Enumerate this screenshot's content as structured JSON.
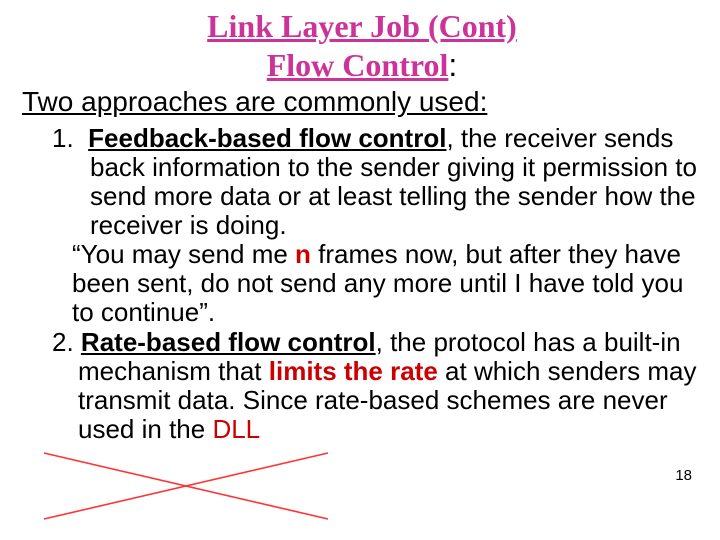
{
  "title": "Link Layer Job (Cont)",
  "subtitle": "Flow Control",
  "subtitle_colon": ":",
  "intro": "Two approaches are commonly used:",
  "item1": {
    "num": "1.",
    "lead": "Feedback-based flow control",
    "rest": ", the receiver sends back information to the sender giving it permission to send more data or at least telling the sender how the receiver is doing."
  },
  "quote1": {
    "pre": "“You may send me ",
    "n": "n",
    "mid": " frames now, but after they have been sent, do not send any more until I have told you to continue”."
  },
  "item2": {
    "num": "2.",
    "lead": "Rate-based flow control",
    "seg1": ", the protocol has a built-in mechanism that ",
    "limits": "limits the rate",
    "seg2": " at which senders may transmit data. Since rate-based schemes are never used in the ",
    "dll": "DLL"
  },
  "page_number": "18"
}
